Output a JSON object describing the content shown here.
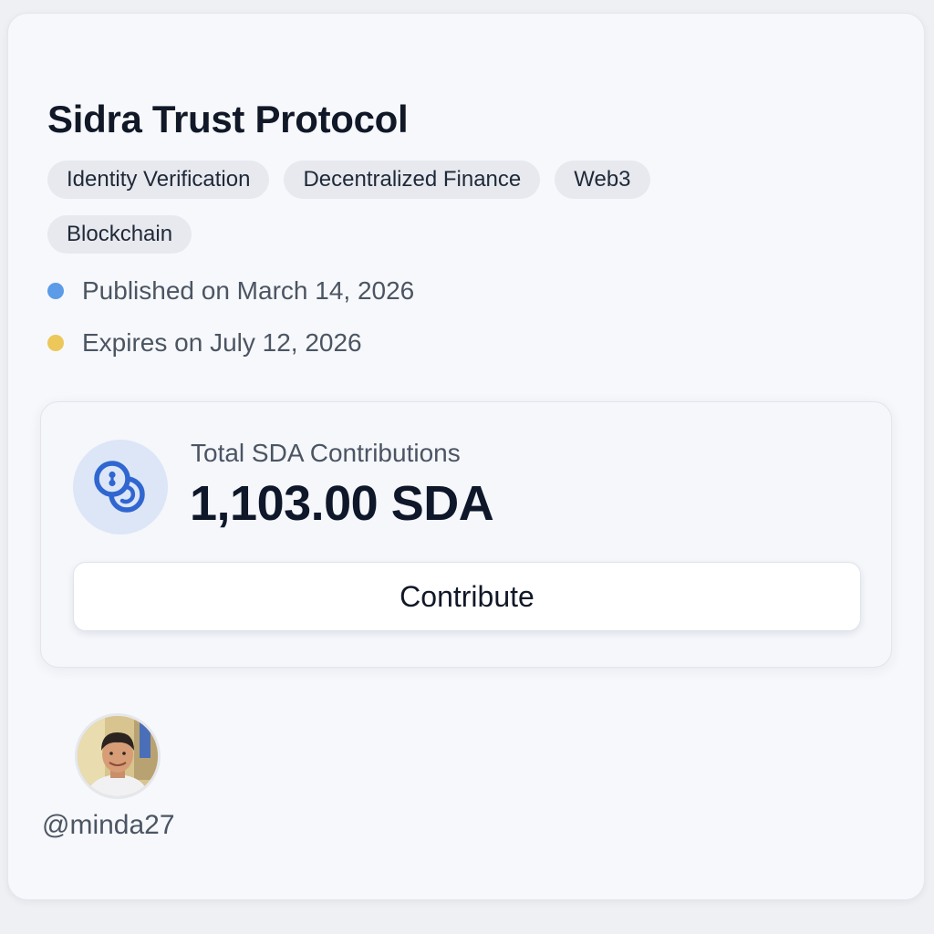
{
  "project": {
    "title": "Sidra Trust Protocol",
    "tags": [
      "Identity Verification",
      "Decentralized Finance",
      "Web3",
      "Blockchain"
    ],
    "published": "Published on March 14, 2026",
    "expires": "Expires on July 12, 2026"
  },
  "stats": {
    "label": "Total SDA Contributions",
    "value": "1,103.00 SDA",
    "icon": "coins-icon"
  },
  "actions": {
    "contribute_label": "Contribute"
  },
  "author": {
    "handle": "@minda27"
  },
  "colors": {
    "published_dot": "#5b9be8",
    "expires_dot": "#ecc75a",
    "accent_blue": "#2f66d0"
  }
}
